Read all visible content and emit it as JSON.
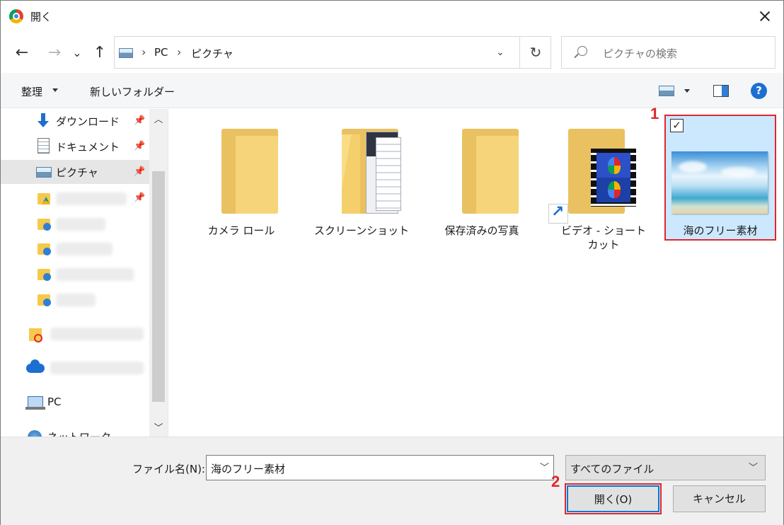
{
  "title": "開く",
  "nav": {
    "back": "←",
    "forward": "→",
    "recent": "⌄",
    "up": "↑",
    "breadcrumb": [
      "PC",
      "ピクチャ"
    ],
    "refresh": "↻",
    "search_placeholder": "ピクチャの検索"
  },
  "toolbar": {
    "organize": "整理",
    "new_folder": "新しいフォルダー",
    "help": "?"
  },
  "sidebar": {
    "items": [
      {
        "label": "ダウンロード",
        "icon": "download-icon",
        "pinned": true
      },
      {
        "label": "ドキュメント",
        "icon": "document-icon",
        "pinned": true
      },
      {
        "label": "ピクチャ",
        "icon": "pictures-icon",
        "pinned": true,
        "selected": true
      },
      {
        "label": "",
        "icon": "google-drive-folder-icon",
        "pinned": true
      },
      {
        "label": "",
        "icon": "user-folder-icon"
      },
      {
        "label": "",
        "icon": "user-folder-icon"
      },
      {
        "label": "",
        "icon": "user-folder-icon"
      },
      {
        "label": "",
        "icon": "user-folder-icon"
      },
      {
        "label": "",
        "icon": "creative-cloud-folder-icon"
      },
      {
        "label": "",
        "icon": "onedrive-icon"
      },
      {
        "label": "PC",
        "icon": "pc-icon"
      },
      {
        "label": "ネットワーク",
        "icon": "network-icon"
      }
    ]
  },
  "files": [
    {
      "name": "カメラ ロール",
      "type": "folder"
    },
    {
      "name": "スクリーンショット",
      "type": "folder-with-pages"
    },
    {
      "name": "保存済みの写真",
      "type": "folder"
    },
    {
      "name": "ビデオ - ショートカット",
      "type": "shortcut"
    },
    {
      "name": "海のフリー素材",
      "type": "image",
      "selected": true
    }
  ],
  "annotations": {
    "step1": "1",
    "step2": "2"
  },
  "footer": {
    "filename_label": "ファイル名(N):",
    "filename_value": "海のフリー素材",
    "filetype_value": "すべてのファイル",
    "open_button": "開く(O)",
    "cancel_button": "キャンセル"
  },
  "colors": {
    "accent": "#0078d7",
    "selection": "#cce8ff",
    "annotation": "#e0262b",
    "folder": "#f5c94c"
  }
}
